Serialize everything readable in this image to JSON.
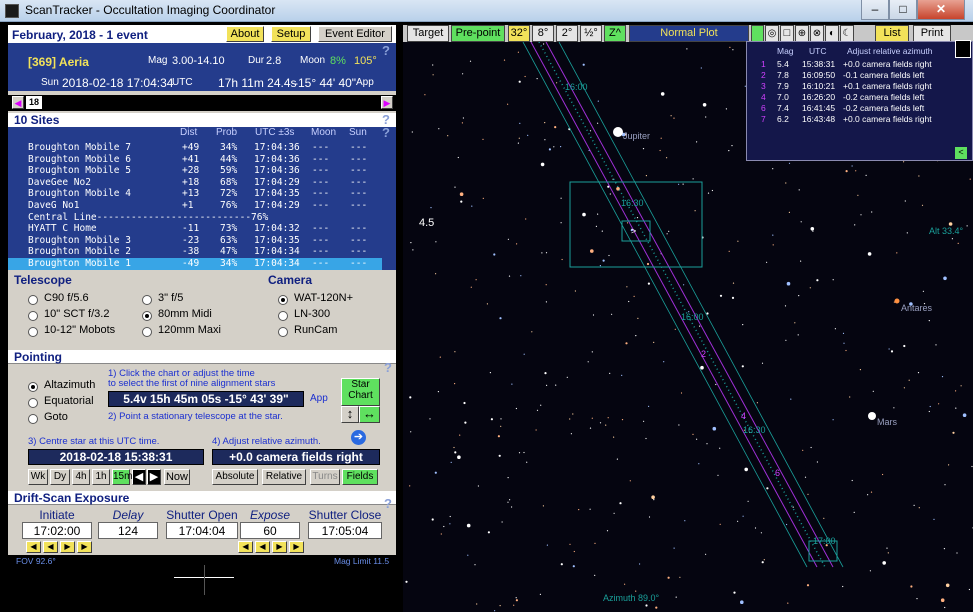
{
  "window": {
    "title": "ScanTracker - Occultation Imaging Coordinator",
    "min": "–",
    "max": "□",
    "close": "✕"
  },
  "header": {
    "date": "February, 2018 - 1 event",
    "about": "About",
    "setup": "Setup",
    "event_editor": "Event Editor",
    "help": "?"
  },
  "event": {
    "name": "[369] Aeria",
    "mag_label": "Mag",
    "mag": "3.00-14.10",
    "dur_label": "Dur",
    "dur": "2.8",
    "moon_label": "Moon",
    "moon_pct": "8%",
    "moon_angle": "105°",
    "dow": "Sun",
    "datetime": "2018-02-18  17:04:34",
    "utc": "UTC",
    "ra": "17h 11m 24.4s",
    "dec": "-15° 44' 40\"",
    "app": "App"
  },
  "day_slider": {
    "day": "18",
    "left": "◀",
    "right": "▶"
  },
  "sites": {
    "title": "10 Sites",
    "cols": [
      "Dist",
      "Prob",
      "UTC ±3s",
      "Moon",
      "Sun"
    ],
    "help": "?",
    "rows": [
      [
        "Broughton Mobile 7",
        "+49",
        "34%",
        "17:04:36",
        "---",
        "---"
      ],
      [
        "Broughton Mobile 6",
        "+41",
        "44%",
        "17:04:36",
        "---",
        "---"
      ],
      [
        "Broughton Mobile 5",
        "+28",
        "59%",
        "17:04:36",
        "---",
        "---"
      ],
      [
        "DaveGee No2",
        "+18",
        "68%",
        "17:04:29",
        "---",
        "---"
      ],
      [
        "Broughton Mobile 4",
        "+13",
        "72%",
        "17:04:35",
        "---",
        "---"
      ],
      [
        "DaveG No1",
        "+1",
        "76%",
        "17:04:29",
        "---",
        "---"
      ],
      [
        "Central Line---------------------------76%",
        "",
        "",
        "",
        "",
        ""
      ],
      [
        "HYATT C Home",
        "-11",
        "73%",
        "17:04:32",
        "---",
        "---"
      ],
      [
        "Broughton Mobile 3",
        "-23",
        "63%",
        "17:04:35",
        "---",
        "---"
      ],
      [
        "Broughton Mobile 2",
        "-38",
        "47%",
        "17:04:34",
        "---",
        "---"
      ],
      [
        "Broughton Mobile 1",
        "-49",
        "34%",
        "17:04:34",
        "---",
        "---"
      ]
    ]
  },
  "telescope": {
    "title": "Telescope",
    "options": [
      "C90 f/5.6",
      "10\" SCT f/3.2",
      "10-12\" Mobots",
      "3\" f/5",
      "80mm Midi",
      "120mm Maxi"
    ],
    "selected": 4
  },
  "camera": {
    "title": "Camera",
    "options": [
      "WAT-120N+",
      "LN-300",
      "RunCam"
    ],
    "selected": 0
  },
  "pointing": {
    "title": "Pointing",
    "help": "?",
    "modes": [
      "Altazimuth",
      "Equatorial",
      "Goto"
    ],
    "selected": 0,
    "step1": "1) Click the chart or adjust the time",
    "step1b": "to select the first of nine alignment stars",
    "star_readout": "5.4v  15h 45m 05s  -15° 43' 39\"",
    "app": "App",
    "step2": "2) Point a stationary telescope at the star.",
    "star_chart": "Star\nChart",
    "step3": "3) Centre star at this UTC time.",
    "utc_time": "2018-02-18   15:38:31",
    "step4": "4) Adjust relative azimuth.",
    "azimuth": "+0.0 camera fields right",
    "time_btns": [
      "Wk",
      "Dy",
      "4h",
      "1h",
      "15m"
    ],
    "now": "Now",
    "az_btns": [
      "Absolute",
      "Relative",
      "Turns",
      "Fields"
    ]
  },
  "drift": {
    "title": "Drift-Scan Exposure",
    "help": "?",
    "cols": [
      "Initiate",
      "Delay",
      "Shutter Open",
      "Expose",
      "Shutter Close"
    ],
    "values": [
      "17:02:00",
      "124",
      "17:04:04",
      "60",
      "17:05:04"
    ]
  },
  "preview": {
    "fov": "FOV 92.6°",
    "mag_limit": "Mag Limit 11.5"
  },
  "chart_toolbar": {
    "target": "Target",
    "prepoint": "Pre-point",
    "b32": "32°",
    "b8": "8°",
    "b2": "2°",
    "b12": "½°",
    "zoom": "Z^",
    "plot": "Normal  Plot",
    "list": "List",
    "print": "Print"
  },
  "overlay": {
    "cols": [
      "Mag",
      "UTC",
      "Adjust relative azimuth"
    ],
    "rows": [
      [
        "1",
        "5.4",
        "15:38:31",
        "+0.0 camera fields right"
      ],
      [
        "2",
        "7.8",
        "16:09:50",
        "-0.1 camera fields left"
      ],
      [
        "3",
        "7.9",
        "16:10:21",
        "+0.1 camera fields right"
      ],
      [
        "4",
        "7.0",
        "16:26:20",
        "-0.2 camera fields left"
      ],
      [
        "6",
        "7.4",
        "16:41:45",
        "-0.2 camera fields left"
      ],
      [
        "7",
        "6.2",
        "16:43:48",
        "+0.0 camera fields right"
      ]
    ]
  },
  "chart": {
    "jupiter": "Jupiter",
    "mars": "Mars",
    "antares": "Antares",
    "alt": "Alt 33.4°",
    "azimuth": "Azimuth 89.0°",
    "mag45": "4.5",
    "t1600a": "16:00",
    "t1630a": "16:30",
    "t1600b": "16:00",
    "t1630b": "16:30",
    "t1700": "17:00",
    "m2": "2",
    "m4": "4",
    "m6": "6",
    "m3": "3"
  }
}
